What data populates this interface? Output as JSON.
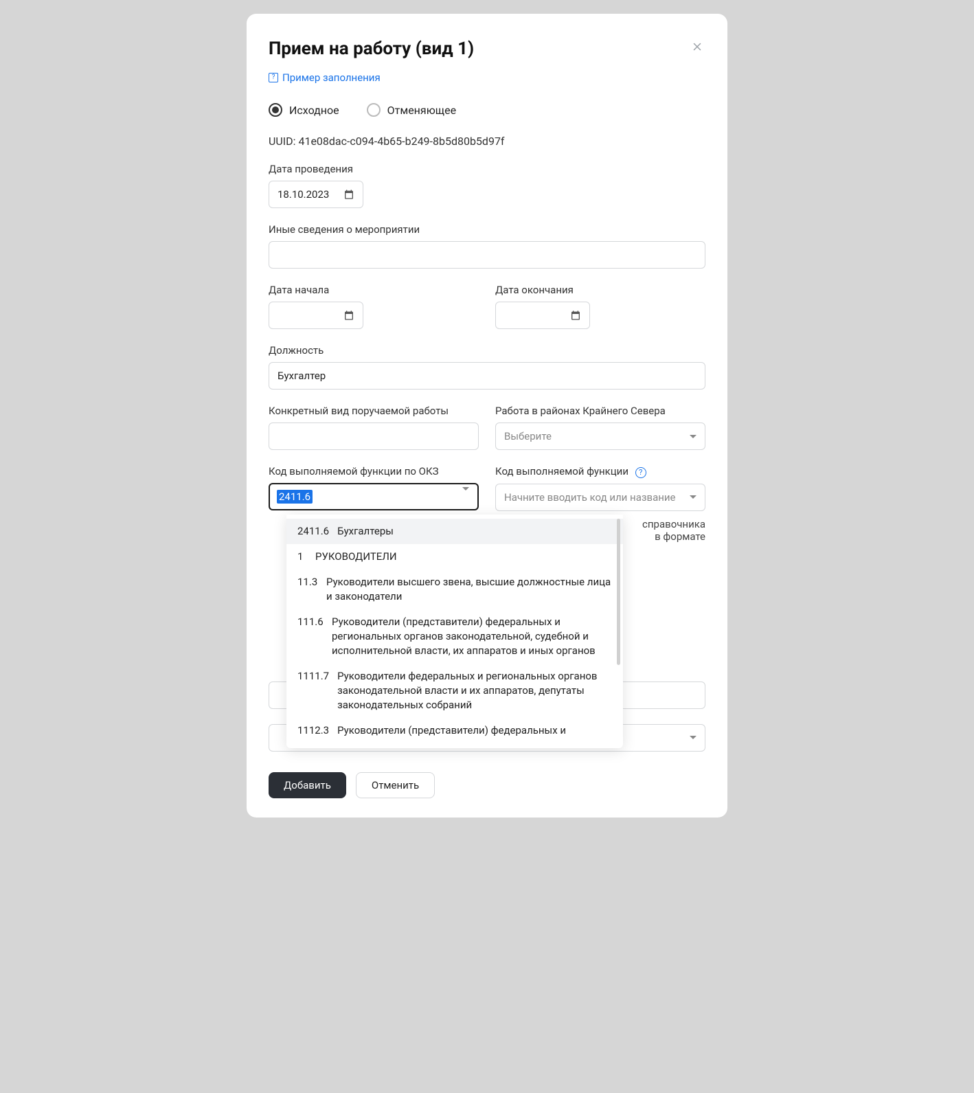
{
  "modal": {
    "title": "Прием на работу (вид 1)",
    "close_icon": "×",
    "example_link": "Пример заполнения"
  },
  "radios": {
    "original": "Исходное",
    "cancelling": "Отменяющее"
  },
  "uuid": {
    "label": "UUID:",
    "value": "41e08dac-c094-4b65-b249-8b5d80b5d97f"
  },
  "fields": {
    "event_date": {
      "label": "Дата проведения",
      "value": "18.10.2023"
    },
    "other_info": {
      "label": "Иные сведения о мероприятии",
      "value": ""
    },
    "start_date": {
      "label": "Дата начала",
      "value": ""
    },
    "end_date": {
      "label": "Дата окончания",
      "value": ""
    },
    "position": {
      "label": "Должность",
      "value": "Бухгалтер"
    },
    "work_type": {
      "label": "Конкретный вид поручаемой работы",
      "value": ""
    },
    "far_north": {
      "label": "Работа в районах Крайнего Севера",
      "placeholder": "Выберите"
    },
    "okz_code": {
      "label": "Код выполняемой функции по ОКЗ",
      "value": "2411.6"
    },
    "func_code": {
      "label": "Код выполняемой функции",
      "placeholder": "Начните вводить код или название"
    },
    "helper_right": "справочника\nв формате"
  },
  "dropdown": {
    "options": [
      {
        "code": "2411.6",
        "text": "Бухгалтеры"
      },
      {
        "code": "1",
        "text": "РУКОВОДИТЕЛИ"
      },
      {
        "code": "11.3",
        "text": "Руководители высшего звена, высшие должностные лица и законодатели"
      },
      {
        "code": "111.6",
        "text": "Руководители (представители) федеральных и региональных органов законодательной, судебной и исполнительной власти, их аппаратов и иных органов"
      },
      {
        "code": "1111.7",
        "text": "Руководители федеральных и региональных органов законодательной власти и их аппаратов, депутаты законодательных собраний"
      },
      {
        "code": "1112.3",
        "text": "Руководители (представители) федеральных и"
      }
    ]
  },
  "footer": {
    "add": "Добавить",
    "cancel": "Отменить"
  }
}
